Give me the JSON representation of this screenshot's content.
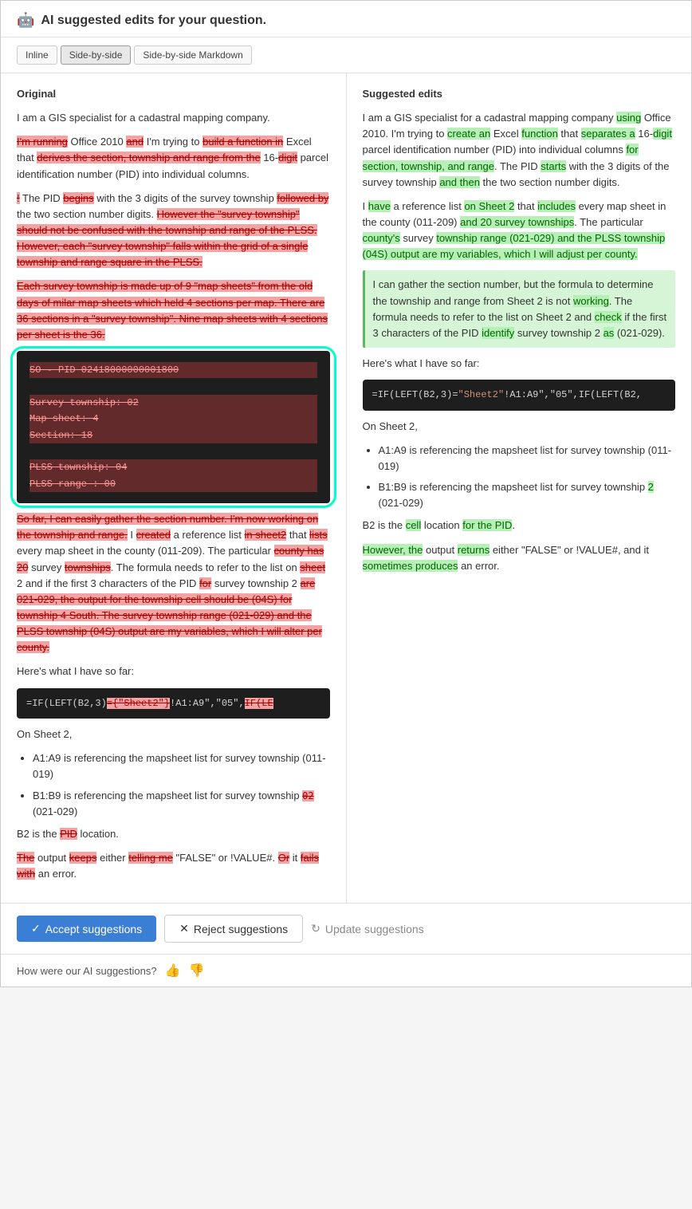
{
  "header": {
    "icon": "🤖",
    "title": "AI suggested edits for your question."
  },
  "tabs": [
    {
      "label": "Inline",
      "active": false
    },
    {
      "label": "Side-by-side",
      "active": true
    },
    {
      "label": "Side-by-side Markdown",
      "active": false
    }
  ],
  "original": {
    "label": "Original"
  },
  "suggested": {
    "label": "Suggested edits"
  },
  "footer": {
    "accept_label": "Accept suggestions",
    "reject_label": "Reject suggestions",
    "update_label": "Update suggestions"
  },
  "feedback": {
    "label": "How were our AI suggestions?"
  }
}
